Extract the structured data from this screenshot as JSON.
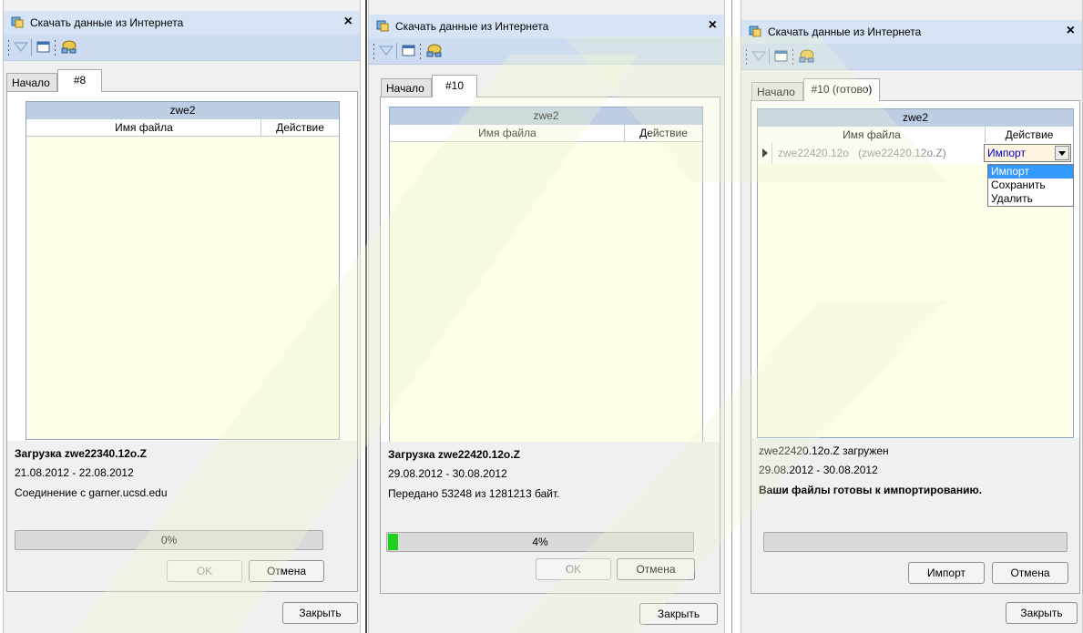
{
  "common": {
    "window_title": "Скачать данные из Интернета",
    "close_glyph": "×",
    "tab_start": "Начало",
    "group_name": "zwe2",
    "col_filename": "Имя файла",
    "col_action": "Действие",
    "close_button": "Закрыть",
    "cancel_button": "Отмена",
    "ok_button": "OK",
    "import_button": "Импорт"
  },
  "win1": {
    "tab_active": "#8",
    "status_line1": "Загрузка zwe22340.12o.Z",
    "status_line2": "21.08.2012 - 22.08.2012",
    "status_line3": "Соединение с garner.ucsd.edu",
    "progress_value": 0,
    "progress_label": "0%"
  },
  "win2": {
    "tab_active": "#10",
    "status_line1": "Загрузка zwe22420.12o.Z",
    "status_line2": "29.08.2012 - 30.08.2012",
    "status_line3": "Передано 53248 из 1281213 байт.",
    "progress_value": 4,
    "progress_label": "4%"
  },
  "win3": {
    "tab_active": "#10 (готово)",
    "row_filename": "zwe22420.12o   (zwe22420.12o.Z)",
    "row_action_value": "Импорт",
    "dropdown_options": [
      "Импорт",
      "Сохранить",
      "Удалить"
    ],
    "status_line1": "zwe22420.12o.Z загружен",
    "status_line2": "29.08.2012 - 30.08.2012",
    "status_line3": "Ваши файлы готовы к импортированию.",
    "progress_value": 0
  },
  "colors": {
    "titlebar": "#d6e4f5",
    "toolbar": "#cddcf1",
    "grid_background": "#fefee9",
    "grid_header": "#bccde4",
    "progress_fill": "#1fd01f",
    "selected_option": "#3399ff"
  },
  "icons": [
    "download-app-icon",
    "close-icon",
    "filter-icon",
    "window-icon",
    "network-icon",
    "chevron-down-icon",
    "row-pointer-icon"
  ]
}
